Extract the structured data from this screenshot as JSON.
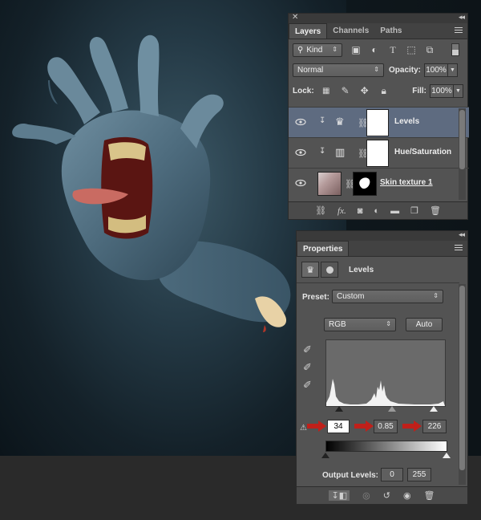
{
  "layers_panel": {
    "tabs": [
      "Layers",
      "Channels",
      "Paths"
    ],
    "active_tab": "Layers",
    "filter_kind": "Kind",
    "blend_mode": "Normal",
    "opacity_label": "Opacity:",
    "opacity_value": "100%",
    "lock_label": "Lock:",
    "fill_label": "Fill:",
    "fill_value": "100%",
    "layers": [
      {
        "name": "Levels",
        "selected": true
      },
      {
        "name": "Hue/Saturation",
        "selected": false
      },
      {
        "name": "Skin texture 1",
        "selected": false
      }
    ],
    "footer_icons": [
      "link-icon",
      "fx-icon",
      "mask-icon",
      "adjustment-icon",
      "folder-icon",
      "new-layer-icon",
      "trash-icon"
    ]
  },
  "properties_panel": {
    "tab": "Properties",
    "adjustment_name": "Levels",
    "preset_label": "Preset:",
    "preset_value": "Custom",
    "channel_value": "RGB",
    "auto_label": "Auto",
    "input_black": "34",
    "input_gamma": "0.85",
    "input_white": "226",
    "output_label": "Output Levels:",
    "output_black": "0",
    "output_white": "255"
  },
  "colors": {
    "panel_bg": "#535353",
    "selection": "#5e6b80",
    "annotation_arrow": "#c0201a"
  }
}
